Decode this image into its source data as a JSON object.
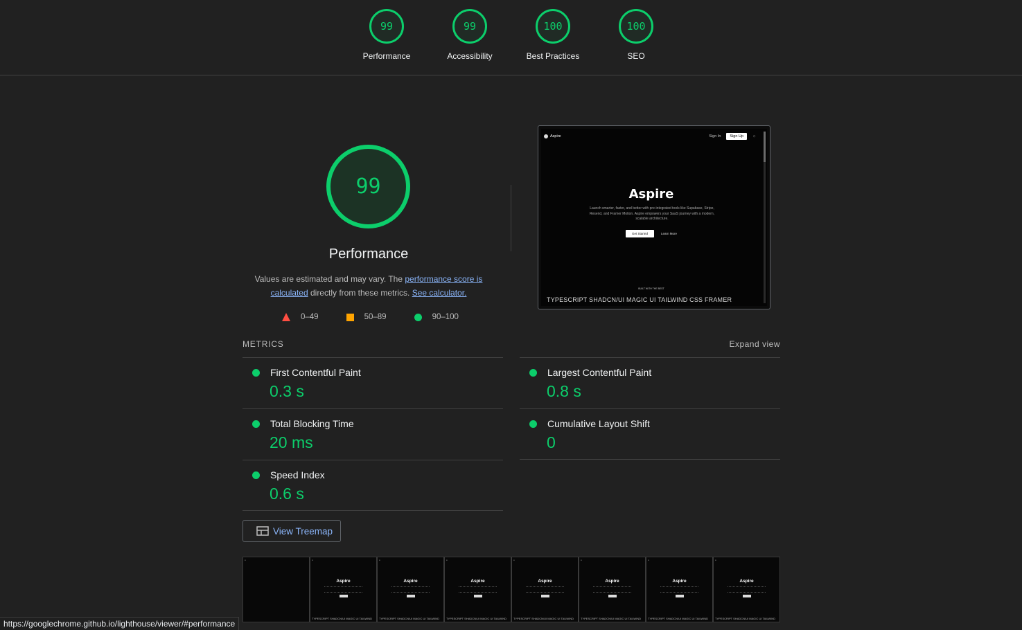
{
  "categories": [
    {
      "score": "99",
      "label": "Performance"
    },
    {
      "score": "99",
      "label": "Accessibility"
    },
    {
      "score": "100",
      "label": "Best Practices"
    },
    {
      "score": "100",
      "label": "SEO"
    }
  ],
  "performance": {
    "score": "99",
    "title": "Performance",
    "desc_part1": "Values are estimated and may vary. The ",
    "desc_link1": "performance score is calculated",
    "desc_part2": " directly from these metrics. ",
    "desc_link2": "See calculator."
  },
  "legend": {
    "fail": "0–49",
    "average": "50–89",
    "pass": "90–100"
  },
  "colors": {
    "pass": "#0cce6b",
    "average": "#ffa400",
    "fail": "#ff4e42",
    "link": "#8ab4f8"
  },
  "preview": {
    "brand": "Aspire",
    "sign_in": "Sign In",
    "sign_up": "Sign Up",
    "hero_title": "Aspire",
    "hero_text": "Launch smarter, faster, and better with pre-integrated tools like Supabase, Stripe, Resend, and Framer Motion. Aspire empowers your SaaS journey with a modern, scalable architecture.",
    "get_started": "Get Started",
    "learn_more": "Learn More",
    "built_with": "BUILT WITH THE BEST",
    "marquee": "TYPESCRIPT  SHADCN/UI  MAGIC UI  TAILWIND CSS  FRAMER"
  },
  "metrics_label": "METRICS",
  "expand_view": "Expand view",
  "metrics": [
    {
      "name": "First Contentful Paint",
      "value": "0.3 s"
    },
    {
      "name": "Largest Contentful Paint",
      "value": "0.8 s"
    },
    {
      "name": "Total Blocking Time",
      "value": "20 ms"
    },
    {
      "name": "Cumulative Layout Shift",
      "value": "0"
    },
    {
      "name": "Speed Index",
      "value": "0.6 s"
    }
  ],
  "treemap_label": "View Treemap",
  "filmstrip": {
    "frame_title": "Aspire",
    "frame_marquee": "TYPESCRIPT  SHADCN/UI  MAGIC UI  TAILWIND"
  },
  "status_url": "https://googlechrome.github.io/lighthouse/viewer/#performance"
}
